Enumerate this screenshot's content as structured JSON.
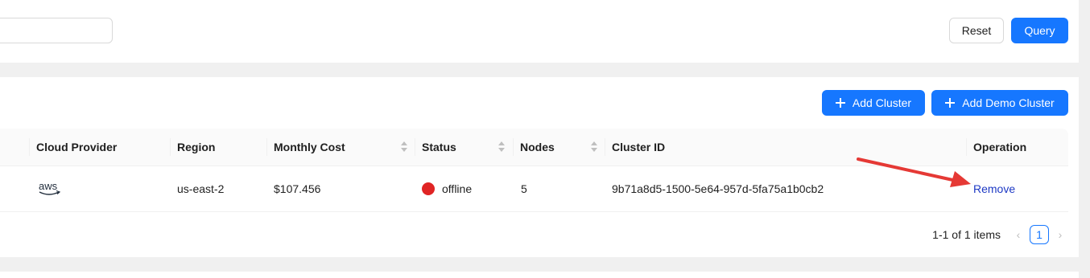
{
  "filter": {
    "search_value": "",
    "reset_label": "Reset",
    "query_label": "Query"
  },
  "toolbar": {
    "add_cluster_label": "Add Cluster",
    "add_demo_cluster_label": "Add Demo Cluster"
  },
  "table": {
    "columns": {
      "cloud_provider": "Cloud Provider",
      "region": "Region",
      "monthly_cost": "Monthly Cost",
      "status": "Status",
      "nodes": "Nodes",
      "cluster_id": "Cluster ID",
      "operation": "Operation"
    },
    "rows": [
      {
        "cloud_provider_icon": "aws-logo-icon",
        "cloud_provider_logo_text": "aws",
        "region": "us-east-2",
        "monthly_cost": "$107.456",
        "status": "offline",
        "status_color": "#e02424",
        "nodes": "5",
        "cluster_id": "9b71a8d5-1500-5e64-957d-5fa75a1b0cb2",
        "operation": "Remove"
      }
    ]
  },
  "pagination": {
    "total_text": "1-1 of 1 items",
    "current_page": "1"
  },
  "colors": {
    "primary": "#1677ff",
    "annotation_arrow": "#e53935",
    "link": "#1d39c4"
  }
}
